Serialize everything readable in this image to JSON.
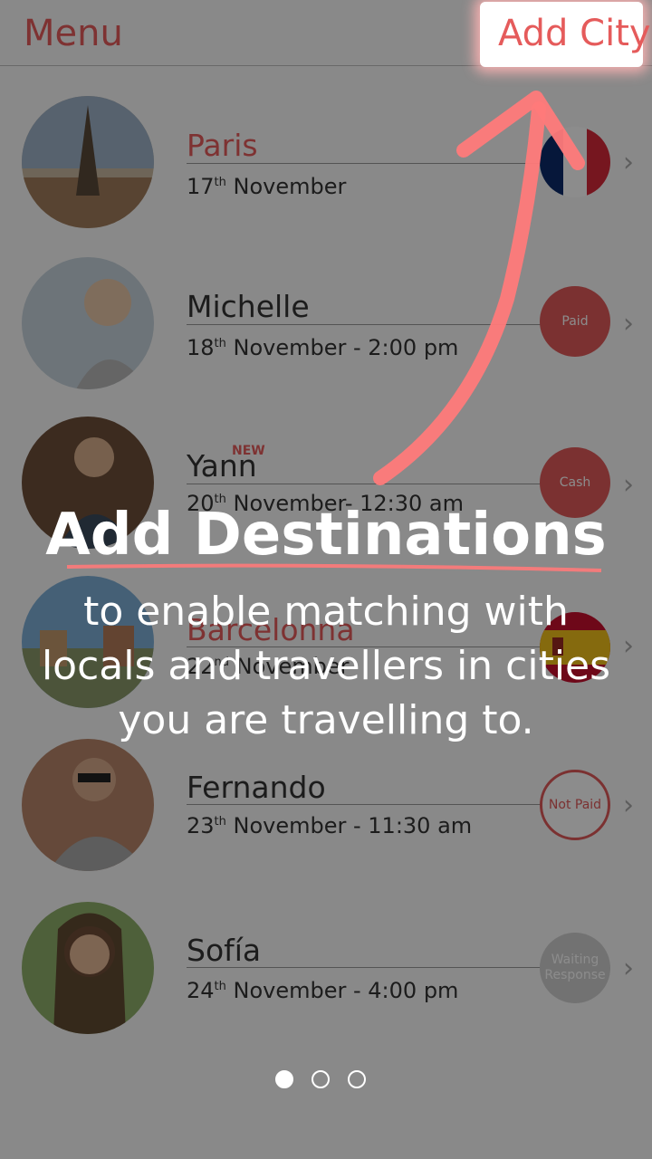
{
  "header": {
    "menu_label": "Menu",
    "add_city_label": "Add City"
  },
  "items": [
    {
      "title": "Paris",
      "date": "17",
      "suffix": "th",
      "rest": " November",
      "badge": "",
      "badge_type": "flag-fr"
    },
    {
      "title": "Michelle",
      "date": "18",
      "suffix": "th",
      "rest": " November - 2:00 pm",
      "badge": "Paid",
      "badge_type": "red"
    },
    {
      "title": "Yann",
      "new_tag": "NEW",
      "date": "20",
      "suffix": "th",
      "rest": " November- 12:30 am",
      "badge": "Cash",
      "badge_type": "red"
    },
    {
      "title": "Barcelonna",
      "date": "22",
      "suffix": "nd",
      "rest": " November",
      "badge": "",
      "badge_type": "flag-es"
    },
    {
      "title": "Fernando",
      "date": "23",
      "suffix": "th",
      "rest": " November - 11:30 am",
      "badge": "Not Paid",
      "badge_type": "outline"
    },
    {
      "title": "Sofía",
      "date": "24",
      "suffix": "th",
      "rest": " November - 4:00 pm",
      "badge": "Waiting Response",
      "badge_type": "grey"
    }
  ],
  "onboarding": {
    "headline": "Add Destinations",
    "body": "to enable matching with locals and travellers in cities you are travelling to.",
    "page": 1,
    "pages": 3
  },
  "colors": {
    "accent": "#e55b5b",
    "overlay": "rgba(0,0,0,0.45)"
  }
}
